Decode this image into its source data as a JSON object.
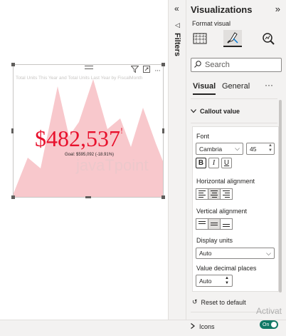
{
  "visual": {
    "title": "Total Units This Year and Total Units Last Year by FiscalMonth",
    "callout_value": "$482,537",
    "callout_suffix": "!",
    "goal": "Goal: $595,092 (-18.91%)",
    "watermark": "javaTpoint",
    "accent_color": "#e8112d",
    "area_color": "#f8c8cc"
  },
  "filters": {
    "collapse_icon": "double-chevron-left-icon",
    "label": "Filters"
  },
  "pane": {
    "title": "Visualizations",
    "expand_icon": "double-chevron-right-icon",
    "format_visual_label": "Format visual",
    "search_placeholder": "Search",
    "tabs": {
      "visual": "Visual",
      "general": "General",
      "more": "···"
    },
    "callout_section": "Callout value",
    "font_label": "Font",
    "font_family": "Cambria",
    "font_size": "45",
    "bold": "B",
    "italic": "I",
    "underline": "U",
    "horizontal_alignment_label": "Horizontal alignment",
    "vertical_alignment_label": "Vertical alignment",
    "display_units_label": "Display units",
    "display_units_value": "Auto",
    "decimal_places_label": "Value decimal places",
    "decimal_places_value": "Auto",
    "reset_label": "Reset to default",
    "icons_label": "Icons",
    "toggle_label": "On"
  },
  "system": {
    "activate_text": "Activat"
  }
}
